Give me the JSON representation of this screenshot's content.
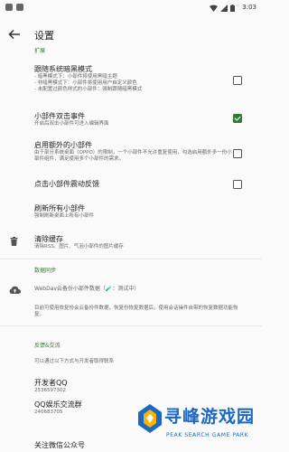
{
  "status_bar": {
    "time": "3:03"
  },
  "appbar": {
    "title": "设置"
  },
  "sections": {
    "expand": "扩展",
    "sync": "数据同步",
    "feedback": "反馈&交流"
  },
  "items": {
    "follow_dark": {
      "title": "跟随系统暗黑模式",
      "subtitle": "- 暗黑模式下：小部件将使用黑暗主题\n- 非暗黑模式下：小部件将使用用户自定义颜色\n- 未配置过颜色样式的小部件：强制跟随暗黑模式",
      "checked": false
    },
    "double_click": {
      "title": "小部件双击事件",
      "subtitle": "开启后双击小部件可进入编辑界面",
      "checked": true
    },
    "extra_widget": {
      "title": "启用额外的小部件",
      "subtitle": "由于部分系统桌面（OPPO）的限制，一个小部件不允许重复使用，勾选启用额外多一份小部件组件，满足使用多个小部件的需求。",
      "checked": false
    },
    "vibrate": {
      "title": "点击小部件震动反馈",
      "checked": false
    },
    "refresh_all": {
      "title": "刷新所有小部件",
      "subtitle": "强制刷新桌面上所有小部件"
    },
    "clear_cache": {
      "title": "清除缓存",
      "subtitle": "清除RSS、图片、气泡小部件的图片缓存"
    },
    "webdav": {
      "text": "WebDav云备份小部件数据（🧪：测试中）"
    },
    "sync_note": "目前可使用恢复份会云备份件数据，恢复份恢复数据后，使用会话操件自带的恢复数据功能恢复。",
    "contact_intro": "可以通过以下方式与开发者取得联系",
    "developer_qq": {
      "title": "开发者QQ",
      "value": "2536597302"
    },
    "qq_group": {
      "title": "QQ娱乐交流群",
      "value": "240683705"
    },
    "wechat": {
      "title": "关注微信公众号"
    }
  },
  "watermark": {
    "cn": "寻峰游戏园",
    "en": "PEAK SEARCH GAME PARK"
  },
  "colors": {
    "accent": "#2e7d32",
    "watermark": "#1d68c2"
  }
}
